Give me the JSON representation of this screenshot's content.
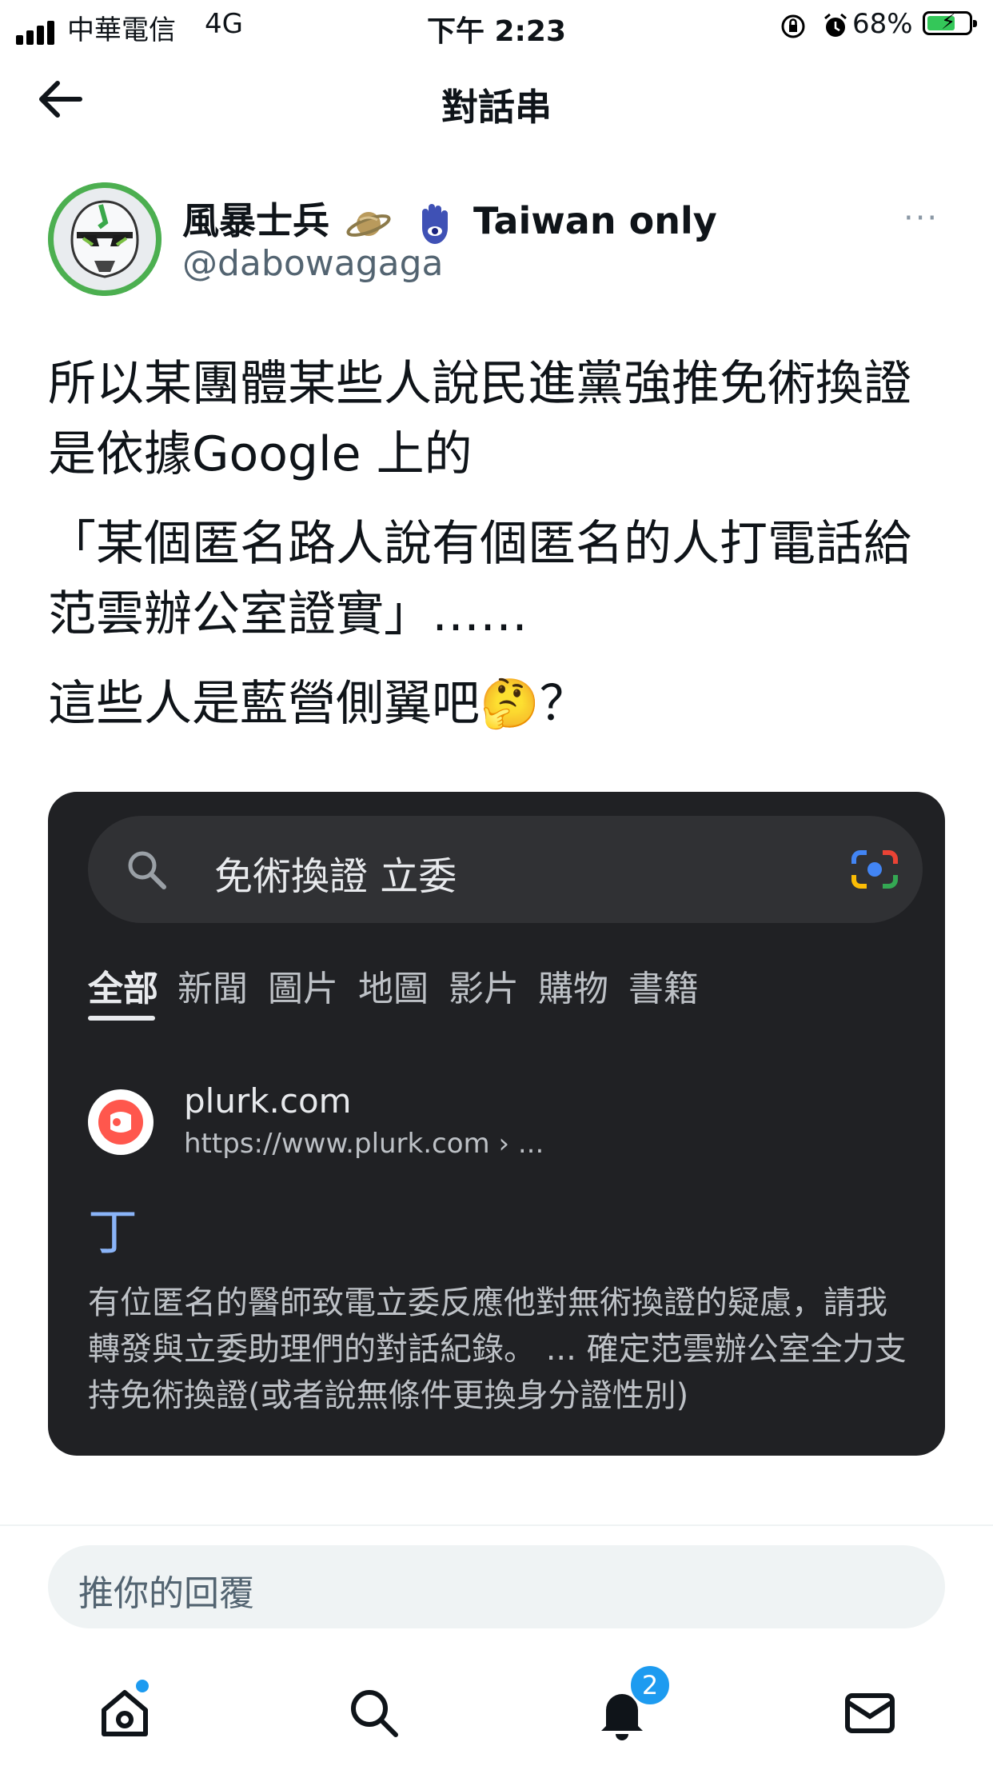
{
  "status_bar": {
    "carrier": "中華電信",
    "network": "4G",
    "time": "下午 2:23",
    "battery": "68%",
    "battery_level": 0.68,
    "icons": [
      "signal-icon",
      "orientation-lock-icon",
      "alarm-icon",
      "battery-charging-icon"
    ]
  },
  "header": {
    "title": "對話串",
    "back_icon": "arrow-left-icon"
  },
  "tweet": {
    "display_name": "風暴士兵",
    "name_suffix": "Taiwan only",
    "name_emojis": [
      "saturn-icon",
      "hamsa-icon"
    ],
    "handle": "@dabowagaga",
    "more_label": "···",
    "paragraphs": [
      "所以某團體某些人說民進黨強推免術換證是依據Google 上的",
      "「某個匿名路人說有個匿名的人打電話給范雲辦公室證實」……",
      "這些人是藍營側翼吧🤔？"
    ]
  },
  "media": {
    "search_query": "免術換證 立委",
    "tabs": [
      "全部",
      "新聞",
      "圖片",
      "地圖",
      "影片",
      "購物",
      "書籍"
    ],
    "active_tab": "全部",
    "result": {
      "site": "plurk.com",
      "url": "https://www.plurk.com › ...",
      "title": "丁",
      "snippet": "有位匿名的醫師致電立委反應他對無術換證的疑慮，請我轉發與立委助理們的對話紀錄。 ... 確定范雲辦公室全力支持免術換證(或者說無條件更換身分證性別)"
    }
  },
  "reply": {
    "placeholder": "推你的回覆"
  },
  "tabbar": {
    "items": [
      "home-icon",
      "search-icon",
      "notifications-icon",
      "messages-icon"
    ],
    "notifications_badge": "2"
  },
  "colors": {
    "accent": "#1d9bf0",
    "dark_card": "#202124",
    "link_blue": "#8ab4f8"
  }
}
